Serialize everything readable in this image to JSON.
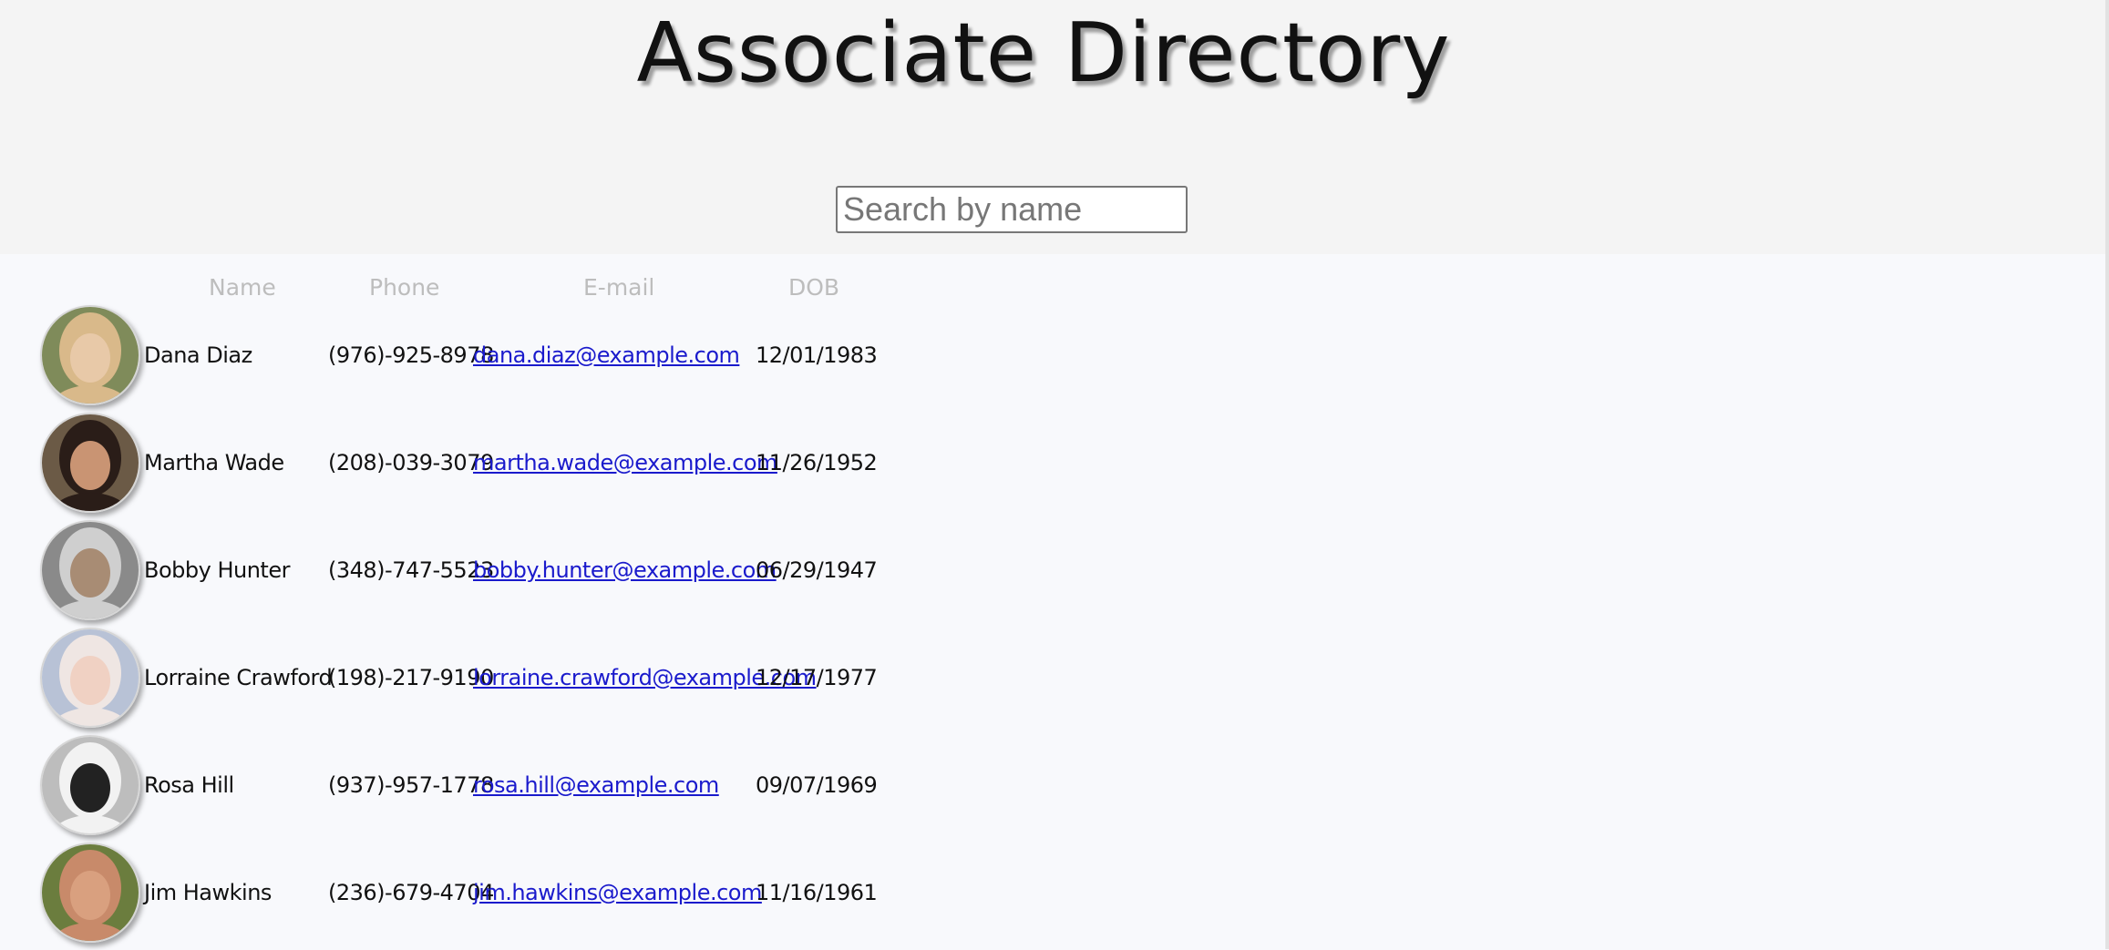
{
  "header": {
    "title": "Associate Directory",
    "search_placeholder": "Search by name",
    "search_value": ""
  },
  "table": {
    "columns": [
      "Name",
      "Phone",
      "E-mail",
      "DOB"
    ],
    "rows": [
      {
        "name": "Dana Diaz",
        "phone": "(976)-925-8978",
        "email": "dana.diaz@example.com",
        "dob": "12/01/1983",
        "avatar_colors": [
          "#d9b98a",
          "#e8c9a8",
          "#7f8b5a"
        ]
      },
      {
        "name": "Martha Wade",
        "phone": "(208)-039-3079",
        "email": "martha.wade@example.com",
        "dob": "11/26/1952",
        "avatar_colors": [
          "#2a1d18",
          "#c99473",
          "#6b5a46"
        ]
      },
      {
        "name": "Bobby Hunter",
        "phone": "(348)-747-5523",
        "email": "bobby.hunter@example.com",
        "dob": "06/29/1947",
        "avatar_colors": [
          "#cfcfcf",
          "#a88c74",
          "#8a8a8a"
        ]
      },
      {
        "name": "Lorraine Crawford",
        "phone": "(198)-217-9190",
        "email": "lorraine.crawford@example.com",
        "dob": "12/17/1977",
        "avatar_colors": [
          "#efe6e3",
          "#f0d1c3",
          "#b8c2d6"
        ]
      },
      {
        "name": "Rosa Hill",
        "phone": "(937)-957-1778",
        "email": "rosa.hill@example.com",
        "dob": "09/07/1969",
        "avatar_colors": [
          "#f2f2f2",
          "#222222",
          "#bdbdbd"
        ]
      },
      {
        "name": "Jim Hawkins",
        "phone": "(236)-679-4704",
        "email": "jim.hawkins@example.com",
        "dob": "11/16/1961",
        "avatar_colors": [
          "#c88a6a",
          "#d9a07f",
          "#6b7d3e"
        ]
      }
    ]
  }
}
